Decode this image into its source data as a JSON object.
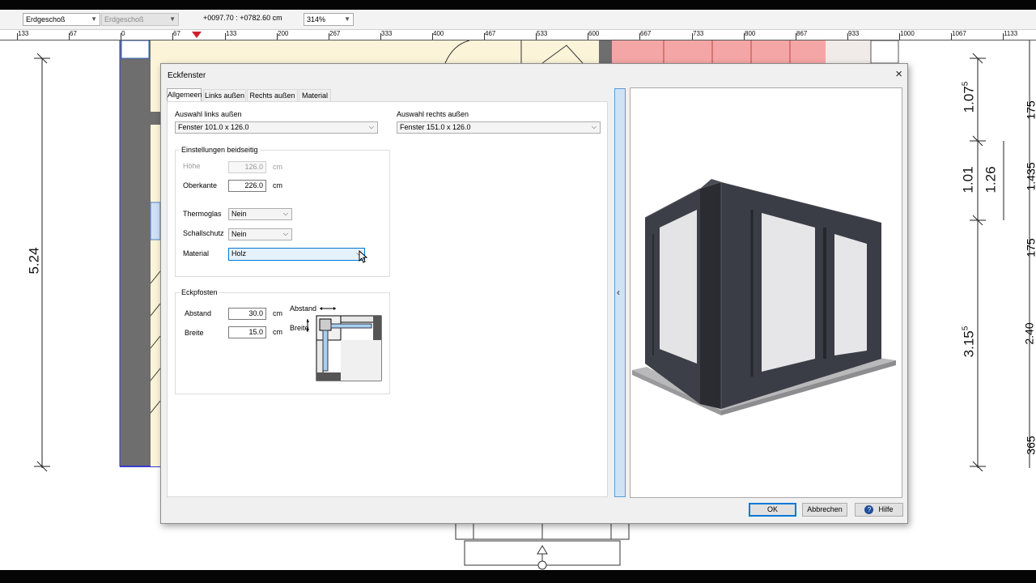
{
  "toolbar": {
    "floor_select": "Erdgeschoß",
    "floor_select_2": "Erdgeschoß",
    "coordinates": "+0097.70 : +0782.60 cm",
    "zoom": "314%"
  },
  "ruler": {
    "ticks": [
      "133",
      "67",
      "0",
      "67",
      "133",
      "200",
      "267",
      "333",
      "400",
      "467",
      "533",
      "600",
      "667",
      "733",
      "800",
      "867",
      "933",
      "1000",
      "1067",
      "1133"
    ]
  },
  "plan": {
    "dim_left": "5.24",
    "dim_right_a": "1.07",
    "dim_right_a_sup": "5",
    "dim_right_b": "1.01",
    "dim_right_c": "1.26",
    "dim_right_d": "3.15",
    "dim_right_d_sup": "5",
    "dim_edge_1": "175",
    "dim_edge_2": "1.435",
    "dim_edge_3": "175",
    "dim_edge_4": "2.40",
    "dim_edge_5": "365"
  },
  "dialog": {
    "title": "Eckfenster",
    "close_icon": "×",
    "tabs": [
      "Allgemeen",
      "Links außen",
      "Rechts außen",
      "Material"
    ],
    "active_tab": 0,
    "left_select_label": "Auswahl links außen",
    "left_select_value": "Fenster 101.0 x 126.0",
    "right_select_label": "Auswahl rechts außen",
    "right_select_value": "Fenster 151.0 x 126.0",
    "group_both": {
      "title": "Einstellungen beidseitig",
      "hoehe_label": "Höhe",
      "hoehe_value": "126.0",
      "hoehe_unit": "cm",
      "oberkante_label": "Oberkante",
      "oberkante_value": "226.0",
      "oberkante_unit": "cm",
      "thermoglas_label": "Thermoglas",
      "thermoglas_value": "Nein",
      "schallschutz_label": "Schallschutz",
      "schallschutz_value": "Nein",
      "material_label": "Material",
      "material_value": "Holz"
    },
    "group_post": {
      "title": "Eckpfosten",
      "abstand_label": "Abstand",
      "abstand_value": "30.0",
      "abstand_unit": "cm",
      "breite_label": "Breite",
      "breite_value": "15.0",
      "breite_unit": "cm",
      "diagram_abstand": "Abstand",
      "diagram_breite": "Breite"
    },
    "buttons": {
      "ok": "OK",
      "cancel": "Abbrechen",
      "help": "Hilfe"
    }
  },
  "colors": {
    "accent": "#0078d7",
    "window_frame": "#3a3d44",
    "glass": "#e6e6e8",
    "plan_red": "#f4a6a6",
    "plan_yellow": "#fbf4d9"
  }
}
